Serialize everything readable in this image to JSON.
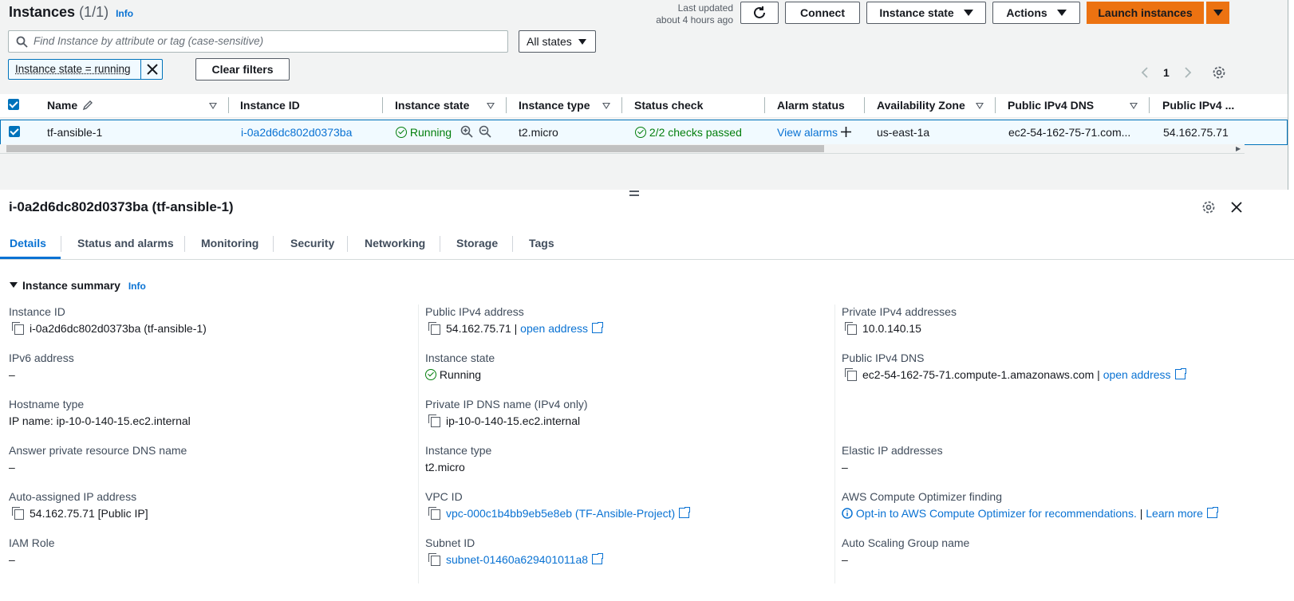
{
  "header": {
    "title": "Instances",
    "count": "(1/1)",
    "info": "Info",
    "last_updated_line1": "Last updated",
    "last_updated_line2": "about 4 hours ago",
    "connect": "Connect",
    "instance_state": "Instance state",
    "actions": "Actions",
    "launch": "Launch instances"
  },
  "search": {
    "placeholder": "Find Instance by attribute or tag (case-sensitive)",
    "states_select": "All states"
  },
  "filter": {
    "token": "Instance state = running",
    "clear": "Clear filters"
  },
  "pagination": {
    "page": "1"
  },
  "table": {
    "columns": [
      "Name",
      "Instance ID",
      "Instance state",
      "Instance type",
      "Status check",
      "Alarm status",
      "Availability Zone",
      "Public IPv4 DNS",
      "Public IPv4 ..."
    ],
    "row": {
      "name": "tf-ansible-1",
      "id": "i-0a2d6dc802d0373ba",
      "state": "Running",
      "type": "t2.micro",
      "status": "2/2 checks passed",
      "alarm": "View alarms",
      "az": "us-east-1a",
      "dns": "ec2-54-162-75-71.com...",
      "ip": "54.162.75.71"
    }
  },
  "detail": {
    "title": "i-0a2d6dc802d0373ba (tf-ansible-1)",
    "tabs": [
      "Details",
      "Status and alarms",
      "Monitoring",
      "Security",
      "Networking",
      "Storage",
      "Tags"
    ],
    "section": "Instance summary",
    "section_info": "Info",
    "col1": {
      "instance_id_label": "Instance ID",
      "instance_id_value": "i-0a2d6dc802d0373ba (tf-ansible-1)",
      "ipv6_label": "IPv6 address",
      "ipv6_value": "–",
      "hostname_label": "Hostname type",
      "hostname_value": "IP name: ip-10-0-140-15.ec2.internal",
      "answer_label": "Answer private resource DNS name",
      "answer_value": "–",
      "auto_ip_label": "Auto-assigned IP address",
      "auto_ip_value": "54.162.75.71 [Public IP]",
      "iam_label": "IAM Role",
      "iam_value": "–"
    },
    "col2": {
      "pub_ip_label": "Public IPv4 address",
      "pub_ip_value": "54.162.75.71",
      "pub_ip_sep": "|",
      "open_address": "open address",
      "state_label": "Instance state",
      "state_value": "Running",
      "private_dns_label": "Private IP DNS name (IPv4 only)",
      "private_dns_value": "ip-10-0-140-15.ec2.internal",
      "type_label": "Instance type",
      "type_value": "t2.micro",
      "vpc_label": "VPC ID",
      "vpc_value": "vpc-000c1b4bb9eb5e8eb (TF-Ansible-Project)",
      "subnet_label": "Subnet ID",
      "subnet_value": "subnet-01460a629401011a8"
    },
    "col3": {
      "private_ip_label": "Private IPv4 addresses",
      "private_ip_value": "10.0.140.15",
      "pub_dns_label": "Public IPv4 DNS",
      "pub_dns_value": "ec2-54-162-75-71.compute-1.amazonaws.com",
      "pub_dns_sep": "|",
      "open_address": "open address",
      "elastic_label": "Elastic IP addresses",
      "elastic_value": "–",
      "optimizer_label": "AWS Compute Optimizer finding",
      "optimizer_link": "Opt-in to AWS Compute Optimizer for recommendations.",
      "optimizer_sep": "|",
      "learn_more": "Learn more",
      "asg_label": "Auto Scaling Group name",
      "asg_value": "–"
    }
  },
  "colors": {
    "accent": "#0972d3",
    "orange": "#ec7211",
    "green": "#037f0c"
  }
}
